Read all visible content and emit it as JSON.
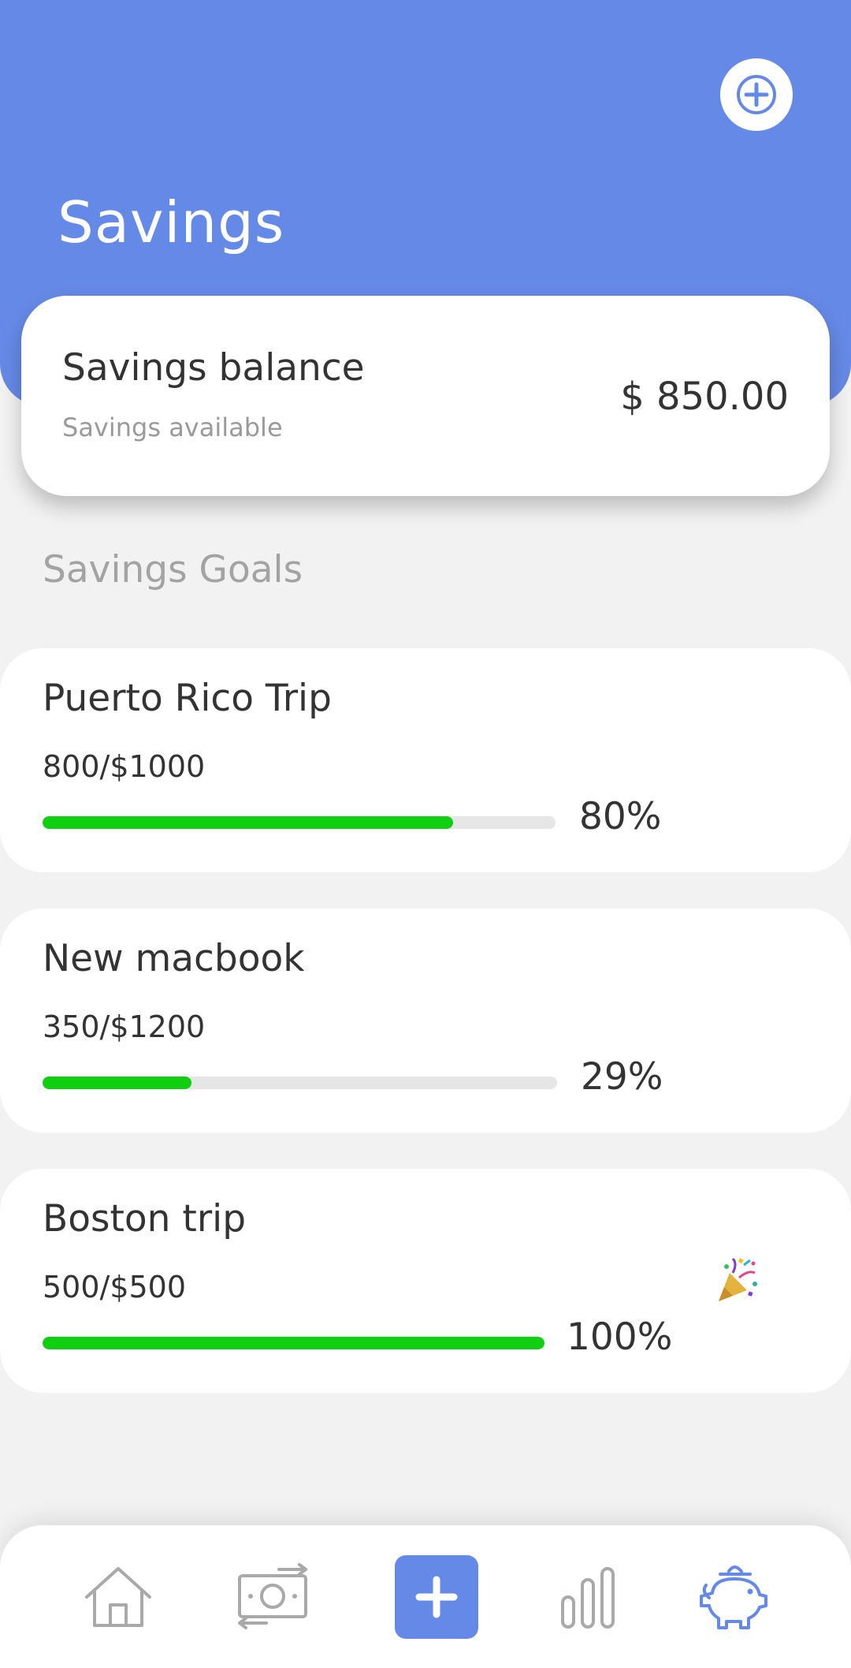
{
  "header": {
    "title": "Savings",
    "add_icon": "plus-circle-icon",
    "color": "#6589e6"
  },
  "balance": {
    "title": "Savings balance",
    "subtitle": "Savings available",
    "amount": "$ 850.00"
  },
  "goals_section": {
    "title": "Savings Goals"
  },
  "goals": [
    {
      "name": "Puerto Rico Trip",
      "amount": "800/$1000",
      "percent_label": "80%",
      "progress": 0.8
    },
    {
      "name": "New macbook",
      "amount": "350/$1200",
      "percent_label": "29%",
      "progress": 0.29
    },
    {
      "name": "Boston trip",
      "amount": "500/$500",
      "percent_label": "100%",
      "progress": 1.0,
      "badge_icon": "party-popper-icon"
    }
  ],
  "progress_color": "#10cf10",
  "bottom_nav": {
    "items": [
      {
        "icon": "home-icon",
        "active": false
      },
      {
        "icon": "money-transfer-icon",
        "active": false
      },
      {
        "icon": "add-icon",
        "active": false
      },
      {
        "icon": "bar-chart-icon",
        "active": false
      },
      {
        "icon": "piggy-bank-icon",
        "active": true
      }
    ]
  }
}
